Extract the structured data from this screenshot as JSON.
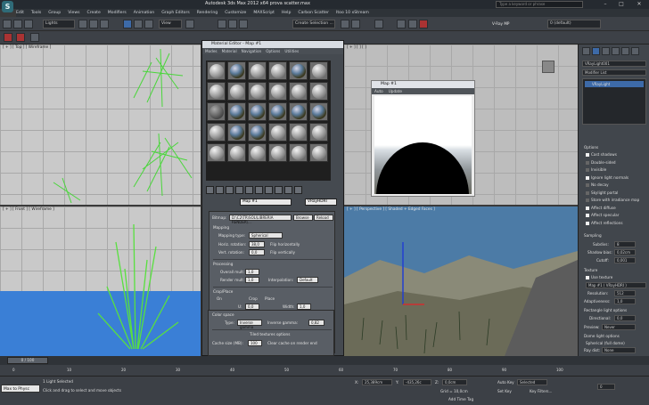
{
  "app": {
    "title": "Autodesk 3ds Max 2012 x64      prova scatter.max",
    "search_placeholder": "Type a keyword or phrase",
    "logo_letter": "S",
    "window_min": "–",
    "window_max": "□",
    "window_close": "✕"
  },
  "menus": [
    "Edit",
    "Tools",
    "Group",
    "Views",
    "Create",
    "Modifiers",
    "Animation",
    "Graph Editors",
    "Rendering",
    "Customize",
    "MAXScript",
    "Help",
    "Carbon Scatter",
    "Itoo 10 xStream"
  ],
  "toolbar": {
    "lights_select": "Lights",
    "view_select": "View",
    "create_selection": "Create Selection ...",
    "vray_label": "V-Ray MP",
    "layer_select": "0 (default)"
  },
  "viewports": {
    "top_label": "[ + ] [ Top ] [ Wireframe ]",
    "front_label": "[ + ] [ Front ] [ Wireframe ]",
    "persp_label": "[ + ] [ Perspective ] [ Shaded + Edged Faces ]",
    "tr_label": "[ + ] [ ] [ ]"
  },
  "material_editor": {
    "title": "Material Editor - Map #1",
    "menus": [
      "Modes",
      "Material",
      "Navigation",
      "Options",
      "Utilities"
    ],
    "map_name": "Map #1",
    "map_type": "VRayHDRI",
    "bitmap_label": "Bitmap:",
    "bitmap_path": "D:\\C2\\TR\\SOL\\LIBRERIA RENDER\\...",
    "browse": "Browse",
    "reload": "Reload",
    "mapping_header": "Mapping",
    "mapping_type_label": "Mapping type:",
    "mapping_type": "Spherical",
    "horiz_rotation_label": "Horiz. rotation:",
    "horiz_rotation": "38,0",
    "flip_h": "Flip horizontally",
    "vert_rotation_label": "Vert. rotation:",
    "vert_rotation": "0,0",
    "flip_v": "Flip vertically",
    "processing_header": "Processing",
    "overall_mult_label": "Overall mult:",
    "overall_mult": "1,0",
    "render_mult_label": "Render mult:",
    "render_mult": "1,0",
    "interpolation_label": "Interpolation:",
    "interpolation": "Default",
    "crop_header": "Crop/Place",
    "crop_on": "On",
    "crop": "Crop",
    "place": "Place",
    "u_label": "U:",
    "u": "0,0",
    "v_label": "V:",
    "v": "0,0",
    "width_label": "Width:",
    "width": "1,0",
    "height_label": "Height:",
    "height": "1,0",
    "rgb_alpha_header": "RGB and alpha source",
    "rgb_output_label": "RGB output:",
    "rgb_output": "RGB color",
    "alpha_source_label": "Alpha source:",
    "alpha_source": "Image alpha",
    "mono_output_label": "Mono output:",
    "mono_output": "RGB intensity",
    "color_space_header": "Color space",
    "type_label": "Type:",
    "type": "Inverse gamma",
    "inverse_gamma_label": "Inverse gamma:",
    "inverse_gamma": "0,82",
    "tiled_header": "Tiled textures options",
    "cache_size_label": "Cache size (MB):",
    "cache_size": "100",
    "clear_cache": "Clear cache on render end"
  },
  "map_window": {
    "title": "Map #1",
    "auto_label": "Auto",
    "update_label": "Update"
  },
  "command_panel": {
    "object_name": "VRayLight001",
    "modifier_list": "Modifier List",
    "stack_item": "VRayLight",
    "options_header": "Options",
    "options": [
      {
        "label": "Cast shadows",
        "checked": true
      },
      {
        "label": "Double-sided",
        "checked": false
      },
      {
        "label": "Invisible",
        "checked": false
      },
      {
        "label": "Ignore light normals",
        "checked": true
      },
      {
        "label": "No decay",
        "checked": false
      },
      {
        "label": "Skylight portal",
        "checked": false
      },
      {
        "label": "Store with irradiance map",
        "checked": false
      },
      {
        "label": "Affect diffuse",
        "checked": true
      },
      {
        "label": "Affect specular",
        "checked": true
      },
      {
        "label": "Affect reflections",
        "checked": true
      }
    ],
    "simple_label": "Simple",
    "sampling_header": "Sampling",
    "subdivs_label": "Subdivs:",
    "subdivs": "8",
    "shadow_bias_label": "Shadow bias:",
    "shadow_bias": "0,02cm",
    "cutoff_label": "Cutoff:",
    "cutoff": "0,001",
    "texture_header": "Texture",
    "use_texture": "Use texture",
    "texture_map": "Map #1  ( VRayHDRI )",
    "resolution_label": "Resolution:",
    "resolution": "512",
    "adaptiveness_label": "Adaptiveness:",
    "adaptiveness": "1,0",
    "rect_options": "Rectangle light options",
    "directional_label": "Directional:",
    "directional": "0,0",
    "preview_label": "Preview:",
    "preview": "Never",
    "dome_options": "Dome light options",
    "spherical_full_dome": "Spherical (full dome)",
    "ray_dist_label": "Ray dist:",
    "ray_dist": "None",
    "photon_emission": "Photon emission"
  },
  "timeline": {
    "frame": "0 / 100",
    "ticks": [
      "0",
      "10",
      "20",
      "30",
      "40",
      "50",
      "60",
      "70",
      "80",
      "90",
      "100"
    ]
  },
  "status": {
    "maxscript": "Max to Physc",
    "lights_selected": "1 Light Selected",
    "prompt": "Click and drag to select and move objects",
    "x_label": "X:",
    "x": "25,389cm",
    "y_label": "Y:",
    "y": "-435,26c",
    "z_label": "Z:",
    "z": "0,0cm",
    "grid": "Grid = 10,0cm",
    "add_time_tag": "Add Time Tag",
    "auto_key": "Auto Key",
    "selected": "Selected",
    "set_key": "Set Key",
    "key_filters": "Key Filters...",
    "frame_field": "0"
  }
}
